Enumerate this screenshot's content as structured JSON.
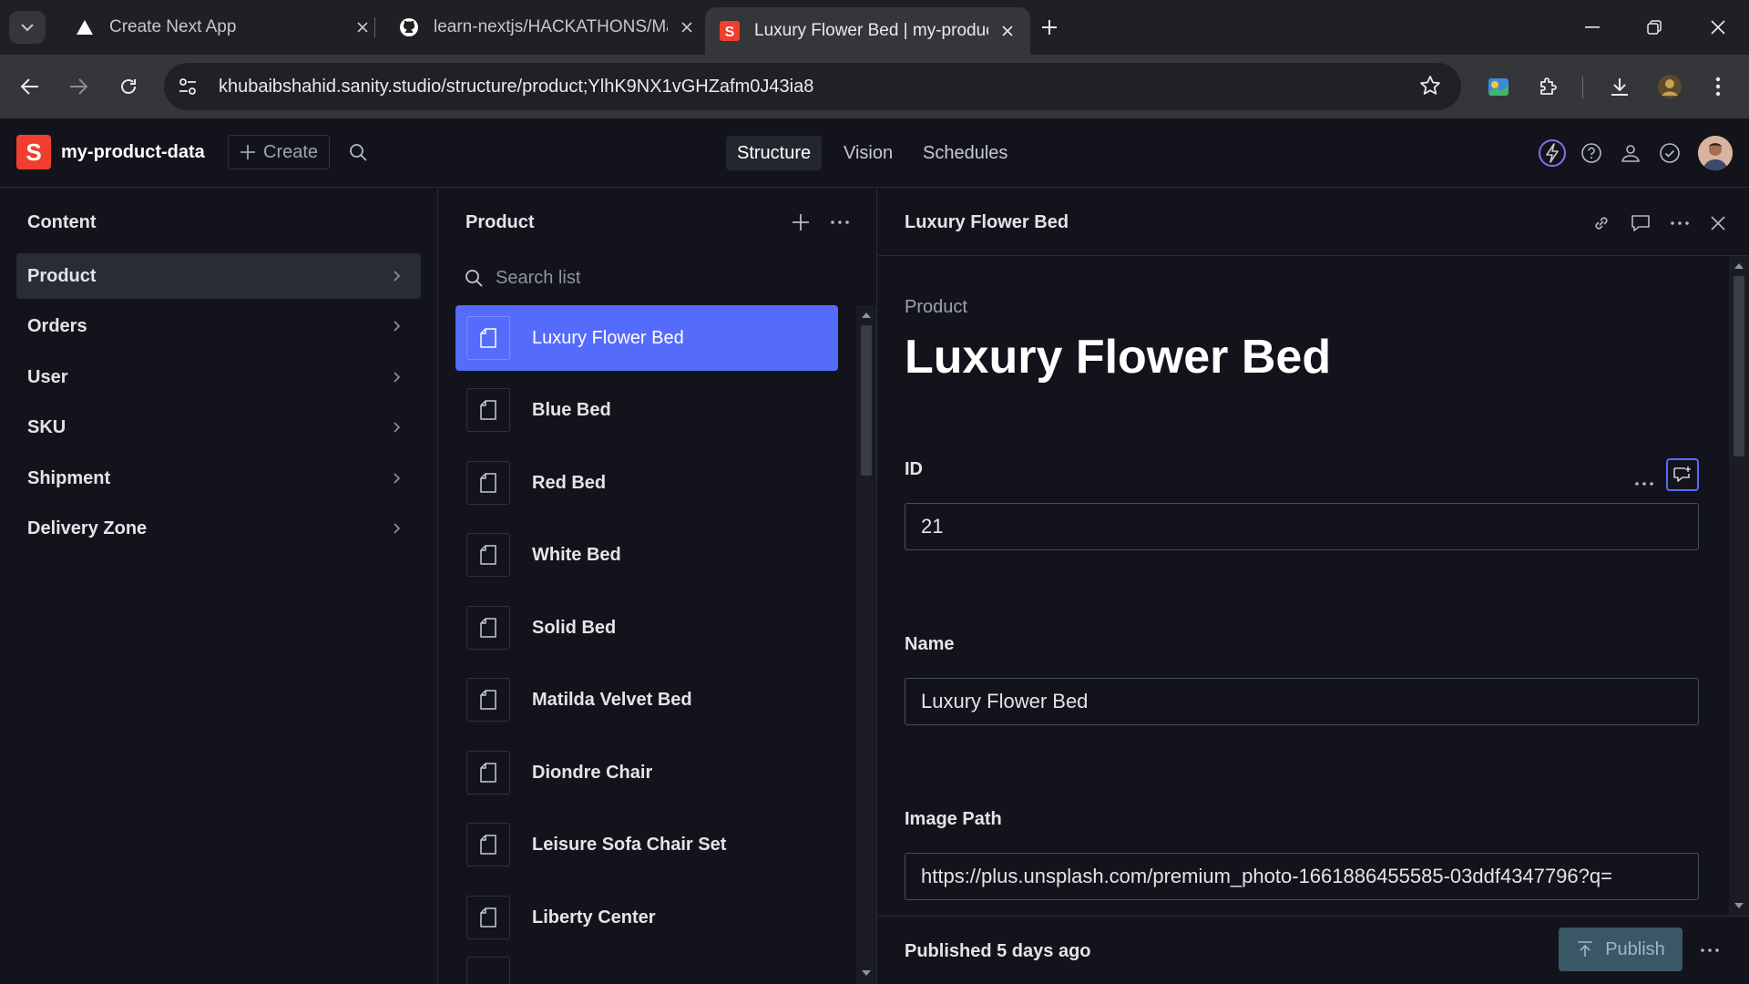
{
  "browser": {
    "tabs": [
      {
        "title": "Create Next App",
        "favicon": "triangle-icon"
      },
      {
        "title": "learn-nextjs/HACKATHONS/Ma",
        "favicon": "github-icon"
      },
      {
        "title": "Luxury Flower Bed | my-product",
        "favicon": "sanity-icon"
      }
    ],
    "address": {
      "host": "khubaibshahid.sanity.studio",
      "path": "/structure/product;YlhK9NX1vGHZafm0J43ia8"
    }
  },
  "studio": {
    "logo_letter": "S",
    "project_name": "my-product-data",
    "create_label": "Create",
    "tools": [
      "Structure",
      "Vision",
      "Schedules"
    ],
    "accent": "#556bfc",
    "brand": "#f03e2f"
  },
  "content_pane": {
    "title": "Content",
    "items": [
      {
        "label": "Product"
      },
      {
        "label": "Orders"
      },
      {
        "label": "User"
      },
      {
        "label": "SKU"
      },
      {
        "label": "Shipment"
      },
      {
        "label": "Delivery Zone"
      }
    ]
  },
  "list_pane": {
    "title": "Product",
    "search_placeholder": "Search list",
    "items": [
      {
        "label": "Luxury Flower Bed"
      },
      {
        "label": "Blue Bed"
      },
      {
        "label": "Red Bed"
      },
      {
        "label": "White Bed"
      },
      {
        "label": "Solid Bed"
      },
      {
        "label": "Matilda Velvet Bed"
      },
      {
        "label": "Diondre Chair"
      },
      {
        "label": "Leisure Sofa Chair Set"
      },
      {
        "label": "Liberty Center"
      }
    ]
  },
  "document": {
    "header_title": "Luxury Flower Bed",
    "type_label": "Product",
    "title": "Luxury Flower Bed",
    "fields": {
      "id": {
        "label": "ID",
        "value": "21"
      },
      "name": {
        "label": "Name",
        "value": "Luxury Flower Bed"
      },
      "image_path": {
        "label": "Image Path",
        "value": "https://plus.unsplash.com/premium_photo-1661886455585-03ddf4347796?q="
      }
    },
    "status": "Published 5 days ago",
    "publish_label": "Publish"
  }
}
